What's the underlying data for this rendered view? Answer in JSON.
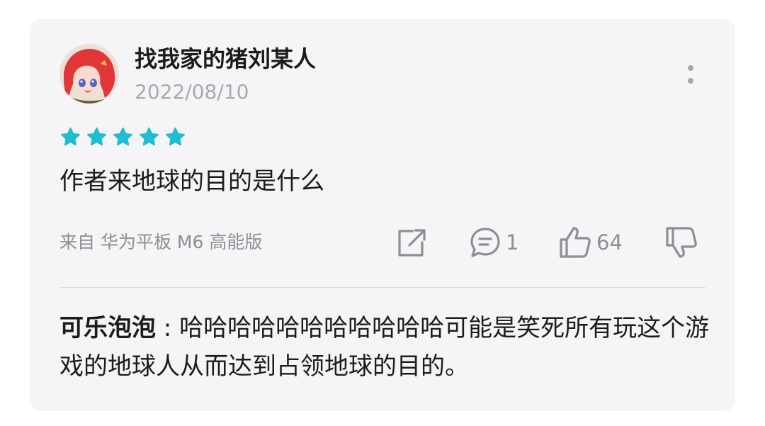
{
  "review": {
    "username": "找我家的猪刘某人",
    "date": "2022/08/10",
    "rating": 5,
    "rating_max": 5,
    "text": "作者来地球的目的是什么",
    "device": "来自 华为平板 M6 高能版",
    "comment_count": "1",
    "like_count": "64"
  },
  "reply": {
    "author": "可乐泡泡",
    "separator": " : ",
    "text": "哈哈哈哈哈哈哈哈哈哈哈可能是笑死所有玩这个游戏的地球人从而达到占领地球的目的。"
  },
  "icons": {
    "more": "more-vertical-icon",
    "share": "share-icon",
    "comment": "comment-icon",
    "like": "thumbs-up-icon",
    "dislike": "thumbs-down-icon",
    "star": "star-icon"
  },
  "colors": {
    "star": "#1fbdd0",
    "card_bg": "#f5f5f7",
    "icon_gray": "#8e8e93"
  }
}
